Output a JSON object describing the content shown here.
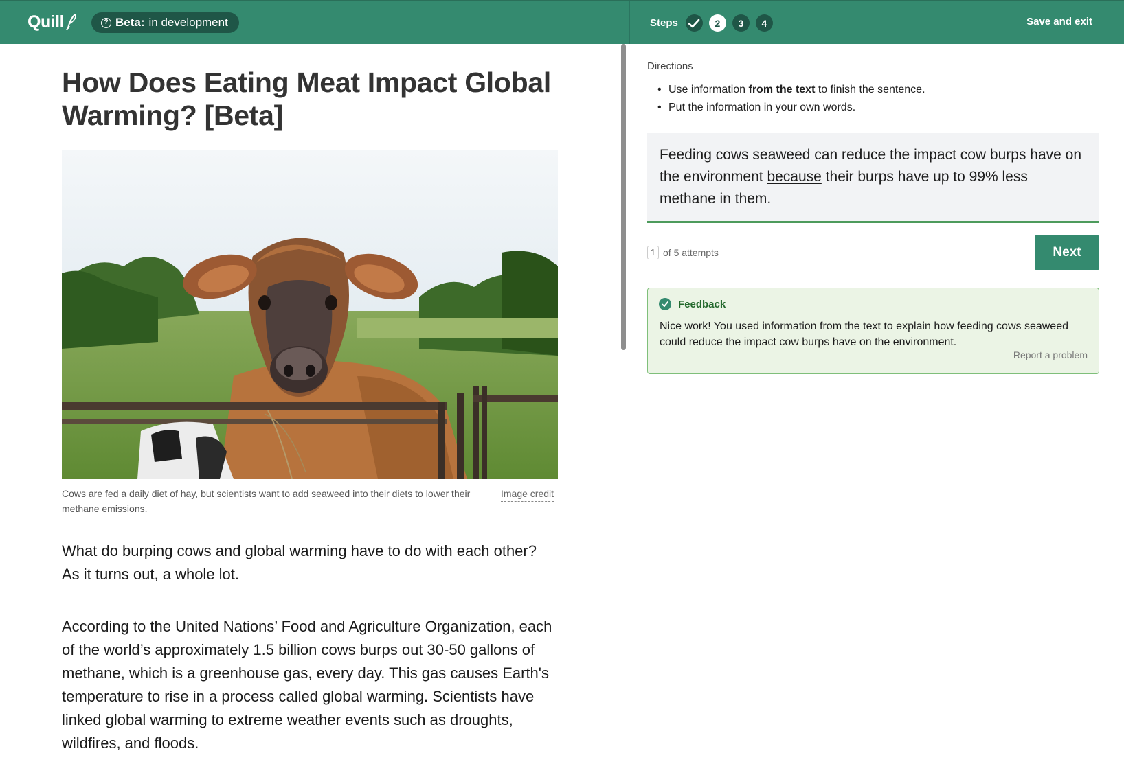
{
  "header": {
    "logo_text": "Quill",
    "beta_label": "Beta:",
    "beta_status": "in development",
    "steps_label": "Steps",
    "steps": [
      {
        "label": "✓",
        "state": "done"
      },
      {
        "label": "2",
        "state": "active"
      },
      {
        "label": "3",
        "state": "todo"
      },
      {
        "label": "4",
        "state": "todo"
      }
    ],
    "save_exit": "Save and exit"
  },
  "article": {
    "title": "How Does Eating Meat Impact Global Warming? [Beta]",
    "image_caption": "Cows are fed a daily diet of hay, but scientists want to add seaweed into their diets to lower their methane emissions.",
    "image_credit": "Image credit",
    "paragraphs": [
      "What do burping cows and global warming have to do with each other? As it turns out, a whole lot.",
      "According to the United Nations’ Food and Agriculture Organization, each of the world’s approximately 1.5 billion cows burps out 30-50 gallons of methane, which is a greenhouse gas, every day. This gas causes Earth's temperature to rise in a process called global warming. Scientists have linked global warming to extreme weather events such as droughts, wildfires, and floods."
    ]
  },
  "activity": {
    "directions_label": "Directions",
    "directions": {
      "item1_before": "Use information ",
      "item1_bold": "from the text",
      "item1_after": " to finish the sentence.",
      "item2": "Put the information in your own words."
    },
    "answer": {
      "before": "Feeding cows seaweed can reduce the impact cow burps have on the environment ",
      "conjunction": "because",
      "after": " their burps have up to 99% less methane in them."
    },
    "attempts": {
      "current": "1",
      "text": "of 5 attempts"
    },
    "next_label": "Next",
    "feedback": {
      "title": "Feedback",
      "text": "Nice work! You used information from the text to explain how feeding cows seaweed could reduce the impact cow burps have on the environment.",
      "report": "Report a problem"
    }
  },
  "colors": {
    "brand_green": "#348a6f",
    "dark_green": "#1f5647",
    "feedback_bg": "#ebf4e5",
    "feedback_border": "#7fbf7a"
  },
  "icons": [
    "quill-pen-icon",
    "help-circle-icon",
    "checkmark-icon",
    "check-circle-icon"
  ]
}
